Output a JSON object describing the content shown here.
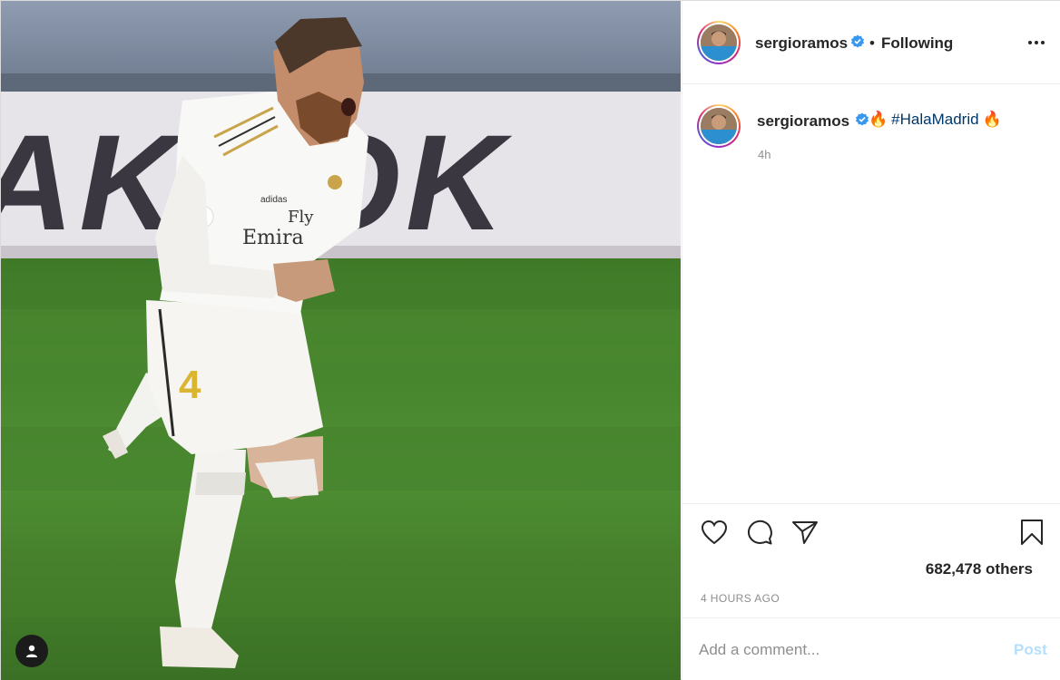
{
  "post": {
    "username": "sergioramos",
    "verified": true,
    "follow_separator": "•",
    "follow_state": "Following",
    "caption": {
      "emoji_before": "🔥",
      "hashtag": "#HalaMadrid",
      "emoji_after": "🔥",
      "relative_time": "4h"
    },
    "likes_text": "682,478 others",
    "timestamp": "4 HOURS AGO"
  },
  "photo": {
    "banner_text": "AKOOK",
    "jersey_sponsor": "Fly Emirates",
    "shorts_number": "4",
    "brand": "adidas"
  },
  "comment": {
    "placeholder": "Add a comment...",
    "post_label": "Post"
  },
  "icons": [
    "user-tag-icon",
    "verified-badge-icon",
    "more-options-icon",
    "heart-icon",
    "comment-icon",
    "share-icon",
    "bookmark-icon"
  ],
  "colors": {
    "verified_blue": "#3897f0",
    "hashtag": "#00376b",
    "post_disabled": "#b2dffc",
    "secondary_text": "#8e8e8e",
    "pitch_green": "#4a8a30"
  }
}
